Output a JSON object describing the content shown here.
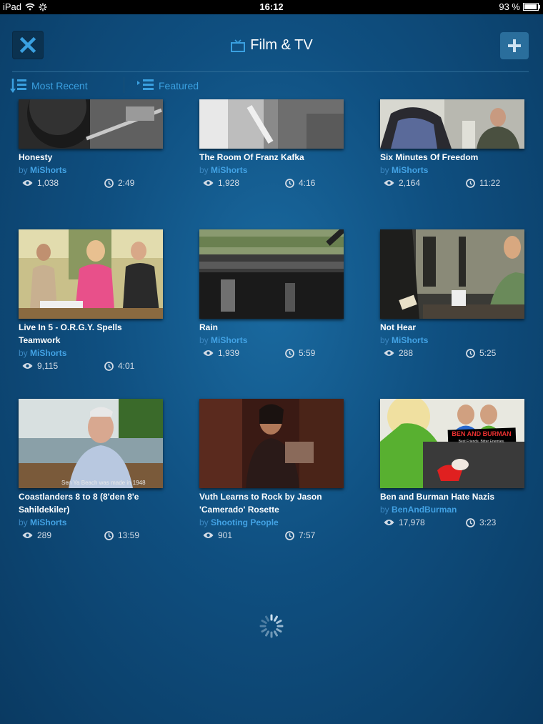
{
  "status": {
    "device": "iPad",
    "time": "16:12",
    "battery": "93 %"
  },
  "header": {
    "title": "Film & TV",
    "close_icon": "close-icon",
    "add_icon": "plus-icon",
    "title_icon": "tv-icon"
  },
  "tabs": [
    {
      "label": "Most Recent",
      "icon": "sort-list-icon"
    },
    {
      "label": "Featured",
      "icon": "list-icon"
    }
  ],
  "videos": [
    {
      "title": "Honesty",
      "by": "by",
      "user": "MiShorts",
      "views": "1,038",
      "duration": "2:49"
    },
    {
      "title": "The Room Of Franz Kafka",
      "by": "by",
      "user": "MiShorts",
      "views": "1,928",
      "duration": "4:16"
    },
    {
      "title": "Six Minutes Of Freedom",
      "by": "by",
      "user": "MiShorts",
      "views": "2,164",
      "duration": "11:22"
    },
    {
      "title": "Live In 5 -  O.R.G.Y. Spells Teamwork",
      "by": "by",
      "user": "MiShorts",
      "views": "9,115",
      "duration": "4:01"
    },
    {
      "title": "Rain",
      "by": "by",
      "user": "MiShorts",
      "views": "1,939",
      "duration": "5:59"
    },
    {
      "title": "Not Hear",
      "by": "by",
      "user": "MiShorts",
      "views": "288",
      "duration": "5:25"
    },
    {
      "title": "Coastlanders 8 to 8 (8'den 8'e Sahildekiler)",
      "by": "by",
      "user": "MiShorts",
      "views": "289",
      "duration": "13:59"
    },
    {
      "title": "Vuth Learns to Rock by Jason 'Camerado' Rosette",
      "by": "by",
      "user": "Shooting People",
      "views": "901",
      "duration": "7:57"
    },
    {
      "title": "Ben and Burman Hate Nazis",
      "by": "by",
      "user": "BenAndBurman",
      "views": "17,978",
      "duration": "3:23"
    }
  ],
  "thumb_texts": {
    "ben_logo": "BEN AND BURMAN",
    "ben_tagline": "Best Friends. Bitter Enemies.",
    "caption": "Sen Ya Beach was made in 1948"
  }
}
